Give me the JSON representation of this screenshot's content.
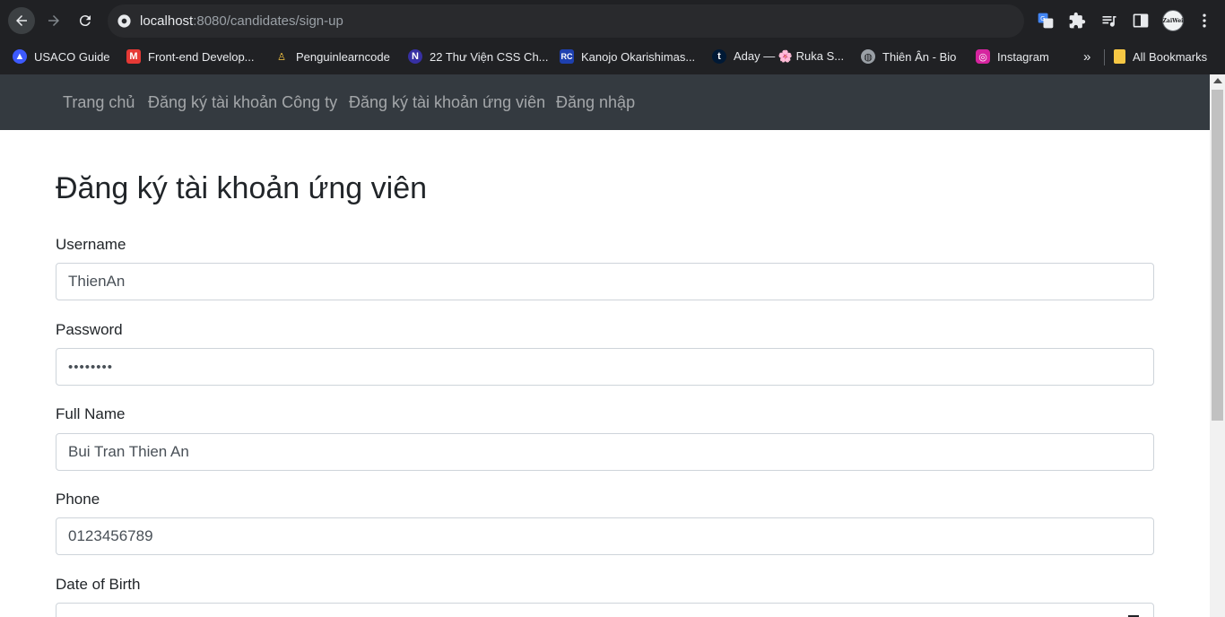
{
  "browser": {
    "url_host": "localhost",
    "url_rest": ":8080/candidates/sign-up",
    "profile_label": "ZaiWei",
    "bookmarks": [
      {
        "label": "USACO Guide",
        "icon": "usaco-icon",
        "color": "#3d5afe"
      },
      {
        "label": "Front-end Develop...",
        "icon": "frontend-icon",
        "color": "#e53935"
      },
      {
        "label": "Penguinlearncode",
        "icon": "penguin-icon",
        "color": "#f5c542"
      },
      {
        "label": "22 Thư Viện CSS Ch...",
        "icon": "n-icon",
        "color": "#3730a3"
      },
      {
        "label": "Kanojo Okarishimas...",
        "icon": "rc-icon",
        "color": "#1e40af"
      },
      {
        "label": "Aday — 🌸 Ruka S...",
        "icon": "tumblr-icon",
        "color": "#001935"
      },
      {
        "label": "Thiên Ân - Bio",
        "icon": "globe-icon",
        "color": "#9aa0a6"
      },
      {
        "label": "Instagram",
        "icon": "instagram-icon",
        "color": "#d6249f"
      }
    ],
    "more_label": "»",
    "all_bookmarks": "All Bookmarks"
  },
  "navbar": {
    "items": [
      "Trang chủ",
      "Đăng ký tài khoản Công ty",
      "Đăng ký tài khoản ứng viên",
      "Đăng nhập"
    ]
  },
  "form": {
    "title": "Đăng ký tài khoản ứng viên",
    "username_label": "Username",
    "username_value": "ThienAn",
    "password_label": "Password",
    "password_value": "••••••••",
    "fullname_label": "Full Name",
    "fullname_value": "Bui Tran Thien An",
    "phone_label": "Phone",
    "phone_value": "0123456789",
    "dob_label": "Date of Birth"
  },
  "colors": {
    "navbar_bg": "#343a40",
    "chrome_bg": "#202124"
  }
}
